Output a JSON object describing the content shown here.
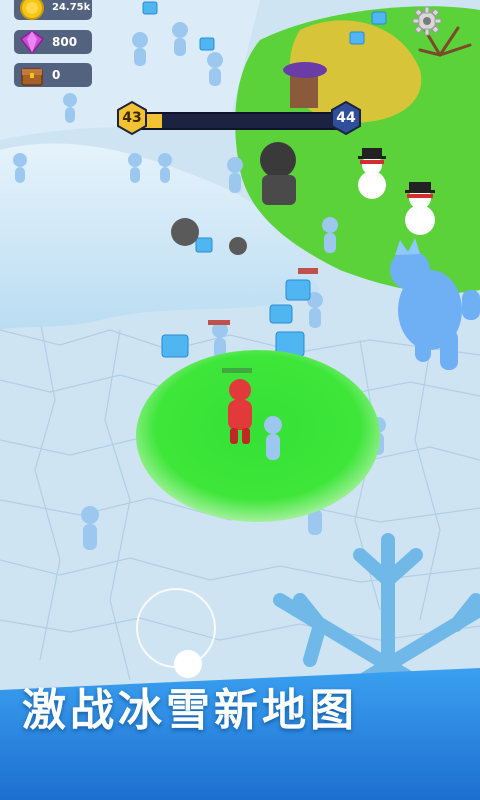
{
  "hud": {
    "coins": "24.75k",
    "gems": "800",
    "chests": "0",
    "icons": [
      "coin-icon",
      "gem-icon",
      "chest-icon",
      "settings-gear-icon"
    ]
  },
  "level": {
    "current": "43",
    "next": "44",
    "progress": 0.12,
    "colors": {
      "fill": "#f2c232",
      "current_badge": "#f2c232",
      "next_badge": "#2f4f9c"
    }
  },
  "banner": {
    "text": "激战冰雪新地图"
  },
  "colors": {
    "ice_ground": "#cfe6f5",
    "grass": "#5bd13a",
    "safe_zone": "#3fe63a",
    "snowflake": "#6fb8e8",
    "player": "#e23a3a",
    "enemies": "#9cc8f0"
  }
}
